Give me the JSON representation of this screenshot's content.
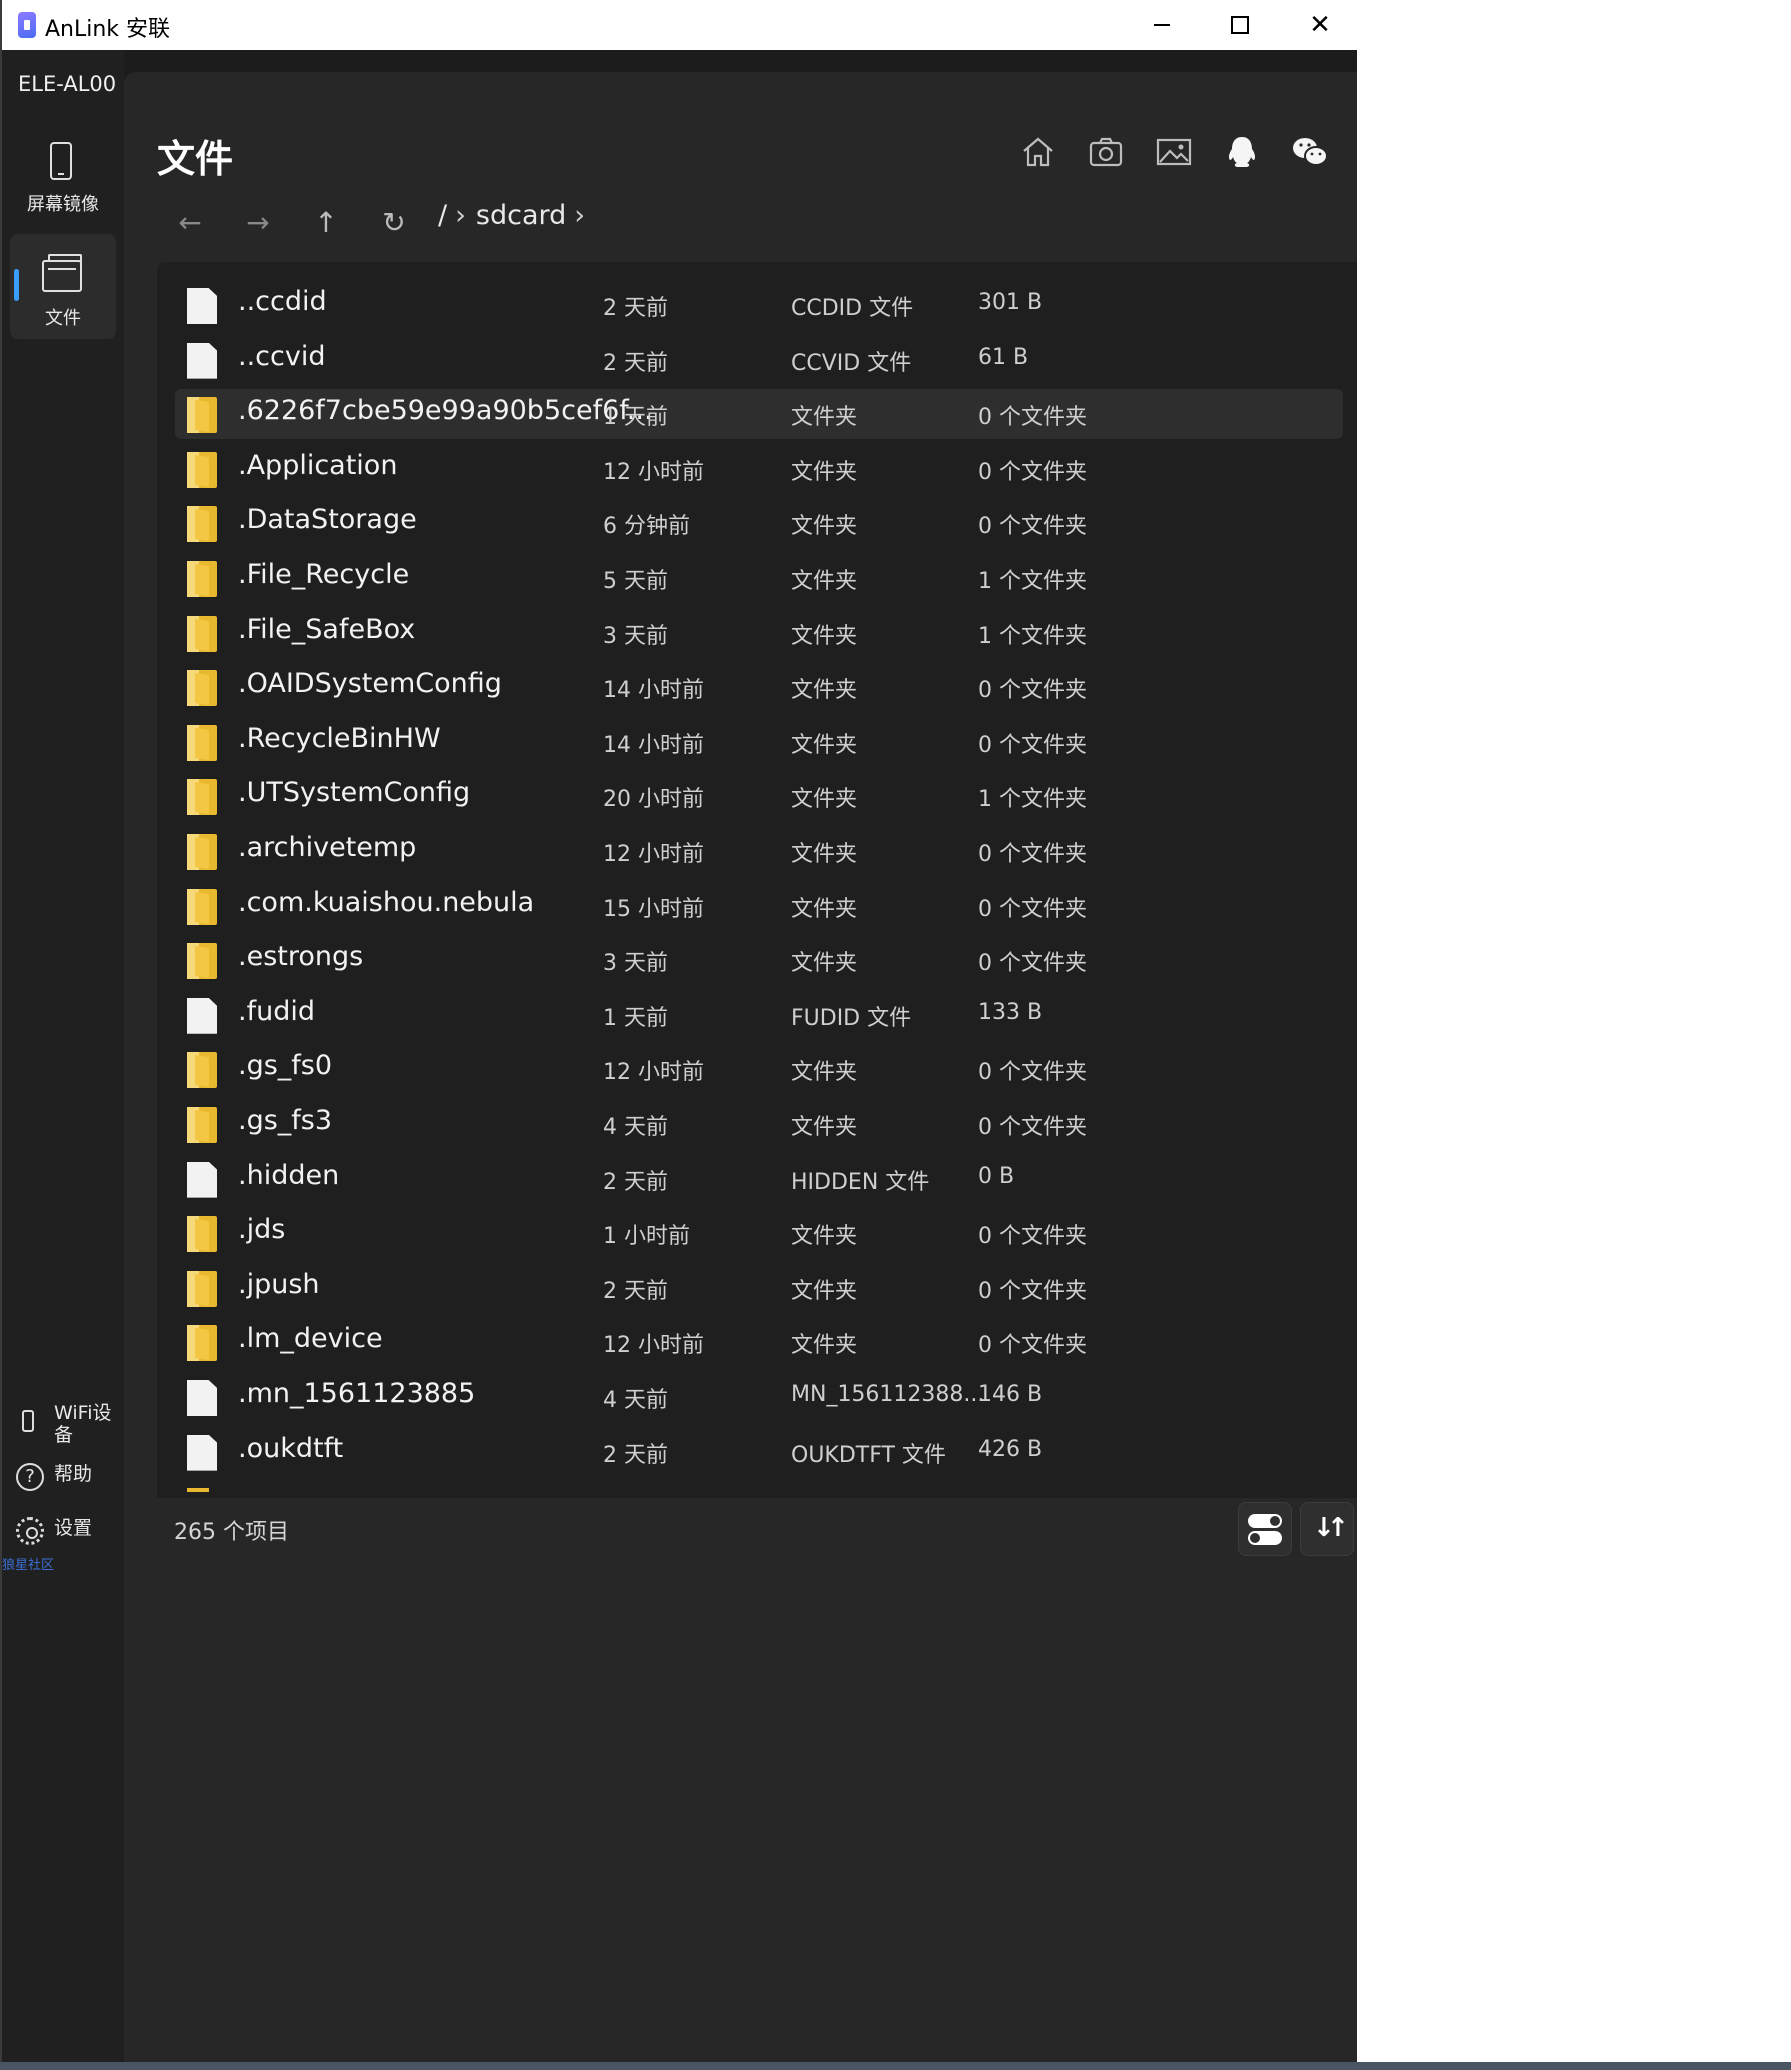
{
  "window": {
    "title": "AnLink 安联"
  },
  "sidebar": {
    "device_name": "ELE-AL00",
    "nav": [
      {
        "label": "屏幕镜像",
        "icon": "phone-icon"
      },
      {
        "label": "文件",
        "icon": "folder-icon",
        "active": true
      }
    ],
    "bottom": {
      "wifi_label": "WiFi设备",
      "help_label": "帮助",
      "settings_label": "设置"
    },
    "community_text": "狼星社区"
  },
  "main": {
    "title": "文件",
    "toolbar_icons": [
      "home-icon",
      "camera-icon",
      "image-icon",
      "qq-icon",
      "wechat-icon"
    ],
    "breadcrumb": {
      "root": "/",
      "current": "sdcard"
    },
    "item_count": "265 个项目"
  },
  "files": [
    {
      "name": "..ccdid",
      "date": "2 天前",
      "type": "CCDID 文件",
      "size": "301 B",
      "kind": "file"
    },
    {
      "name": "..ccvid",
      "date": "2 天前",
      "type": "CCVID 文件",
      "size": "61 B",
      "kind": "file"
    },
    {
      "name": ".6226f7cbe59e99a90b5cef6f...",
      "date": "1 天前",
      "type": "文件夹",
      "size": "0 个文件夹",
      "kind": "folder",
      "selected": true
    },
    {
      "name": ".Application",
      "date": "12 小时前",
      "type": "文件夹",
      "size": "0 个文件夹",
      "kind": "folder"
    },
    {
      "name": ".DataStorage",
      "date": "6 分钟前",
      "type": "文件夹",
      "size": "0 个文件夹",
      "kind": "folder"
    },
    {
      "name": ".File_Recycle",
      "date": "5 天前",
      "type": "文件夹",
      "size": "1 个文件夹",
      "kind": "folder"
    },
    {
      "name": ".File_SafeBox",
      "date": "3 天前",
      "type": "文件夹",
      "size": "1 个文件夹",
      "kind": "folder"
    },
    {
      "name": ".OAIDSystemConfig",
      "date": "14 小时前",
      "type": "文件夹",
      "size": "0 个文件夹",
      "kind": "folder"
    },
    {
      "name": ".RecycleBinHW",
      "date": "14 小时前",
      "type": "文件夹",
      "size": "0 个文件夹",
      "kind": "folder"
    },
    {
      "name": ".UTSystemConfig",
      "date": "20 小时前",
      "type": "文件夹",
      "size": "1 个文件夹",
      "kind": "folder"
    },
    {
      "name": ".archivetemp",
      "date": "12 小时前",
      "type": "文件夹",
      "size": "0 个文件夹",
      "kind": "folder"
    },
    {
      "name": ".com.kuaishou.nebula",
      "date": "15 小时前",
      "type": "文件夹",
      "size": "0 个文件夹",
      "kind": "folder"
    },
    {
      "name": ".estrongs",
      "date": "3 天前",
      "type": "文件夹",
      "size": "0 个文件夹",
      "kind": "folder"
    },
    {
      "name": ".fudid",
      "date": "1 天前",
      "type": "FUDID 文件",
      "size": "133 B",
      "kind": "file"
    },
    {
      "name": ".gs_fs0",
      "date": "12 小时前",
      "type": "文件夹",
      "size": "0 个文件夹",
      "kind": "folder"
    },
    {
      "name": ".gs_fs3",
      "date": "4 天前",
      "type": "文件夹",
      "size": "0 个文件夹",
      "kind": "folder"
    },
    {
      "name": ".hidden",
      "date": "2 天前",
      "type": "HIDDEN 文件",
      "size": "0 B",
      "kind": "file"
    },
    {
      "name": ".jds",
      "date": "1 小时前",
      "type": "文件夹",
      "size": "0 个文件夹",
      "kind": "folder"
    },
    {
      "name": ".jpush",
      "date": "2 天前",
      "type": "文件夹",
      "size": "0 个文件夹",
      "kind": "folder"
    },
    {
      "name": ".lm_device",
      "date": "12 小时前",
      "type": "文件夹",
      "size": "0 个文件夹",
      "kind": "folder"
    },
    {
      "name": ".mn_1561123885",
      "date": "4 天前",
      "type": "MN_156112388...",
      "size": "146 B",
      "kind": "file"
    },
    {
      "name": ".oukdtft",
      "date": "2 天前",
      "type": "OUKDTFT 文件",
      "size": "426 B",
      "kind": "file"
    }
  ]
}
